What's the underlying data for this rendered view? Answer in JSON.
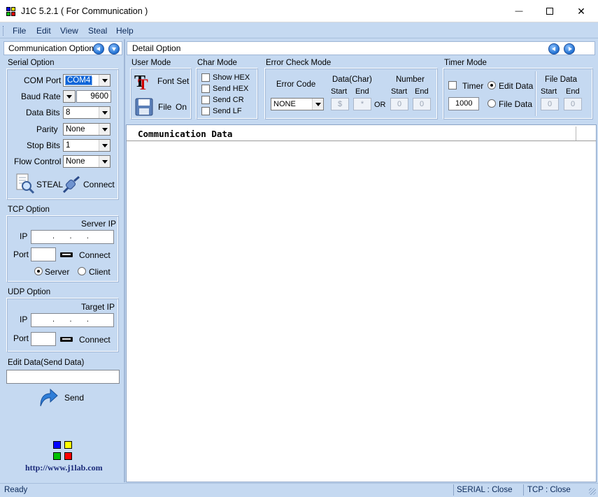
{
  "window": {
    "title": "J1C 5.2.1 ( For Communication )",
    "min_glyph": "—",
    "max_glyph": "☐",
    "close_glyph": "✕"
  },
  "menu": [
    "File",
    "Edit",
    "View",
    "Steal",
    "Help"
  ],
  "left": {
    "header": "Communication Option",
    "serial": {
      "title": "Serial Option",
      "com_port_label": "COM Port",
      "com_port_value": "COM4",
      "baud_rate_label": "Baud Rate",
      "baud_rate_value": "9600",
      "data_bits_label": "Data Bits",
      "data_bits_value": "8",
      "parity_label": "Parity",
      "parity_value": "None",
      "stop_bits_label": "Stop Bits",
      "stop_bits_value": "1",
      "flow_control_label": "Flow Control",
      "flow_control_value": "None",
      "steal_label": "STEAL",
      "connect_label": "Connect"
    },
    "tcp": {
      "title": "TCP Option",
      "server_ip_label": "Server IP",
      "ip_label": "IP",
      "ip_value": ".       .       .",
      "port_label": "Port",
      "connect_label": "Connect",
      "server_label": "Server",
      "client_label": "Client"
    },
    "udp": {
      "title": "UDP Option",
      "target_ip_label": "Target IP",
      "ip_label": "IP",
      "ip_value": ".       .       .",
      "port_label": "Port",
      "connect_label": "Connect"
    },
    "edit": {
      "title": "Edit Data(Send Data)",
      "value": "",
      "send_label": "Send"
    },
    "website": "http://www.j1lab.com"
  },
  "detail": {
    "header": "Detail Option",
    "user_mode": {
      "title": "User Mode",
      "font_set_label": "Font Set",
      "file_label": "File",
      "on_label": "On"
    },
    "char_mode": {
      "title": "Char Mode",
      "show_hex": "Show HEX",
      "send_hex": "Send HEX",
      "send_cr": "Send CR",
      "send_lf": "Send LF"
    },
    "error_check": {
      "title": "Error Check Mode",
      "error_code_label": "Error Code",
      "error_code_value": "NONE",
      "data_char_label": "Data(Char)",
      "number_label": "Number",
      "start_label": "Start",
      "end_label": "End",
      "or_label": "OR",
      "data_start_value": "$",
      "data_end_value": "*",
      "number_start_value": "0",
      "number_end_value": "0"
    },
    "timer_mode": {
      "title": "Timer Mode",
      "timer_label": "Timer",
      "timer_value": "1000",
      "edit_data_label": "Edit Data",
      "file_data_label": "File Data",
      "file_data_title": "File Data",
      "start_label": "Start",
      "end_label": "End",
      "start_value": "0",
      "end_value": "0"
    }
  },
  "data_area": {
    "header": "Communication Data"
  },
  "status": {
    "left": "Ready",
    "serial": "SERIAL : Close",
    "tcp": "TCP : Close"
  },
  "colors": {
    "panel_bg": "#c5d9f1",
    "menu_text": "#0c2a5a",
    "website_text": "#1a2a7a"
  }
}
